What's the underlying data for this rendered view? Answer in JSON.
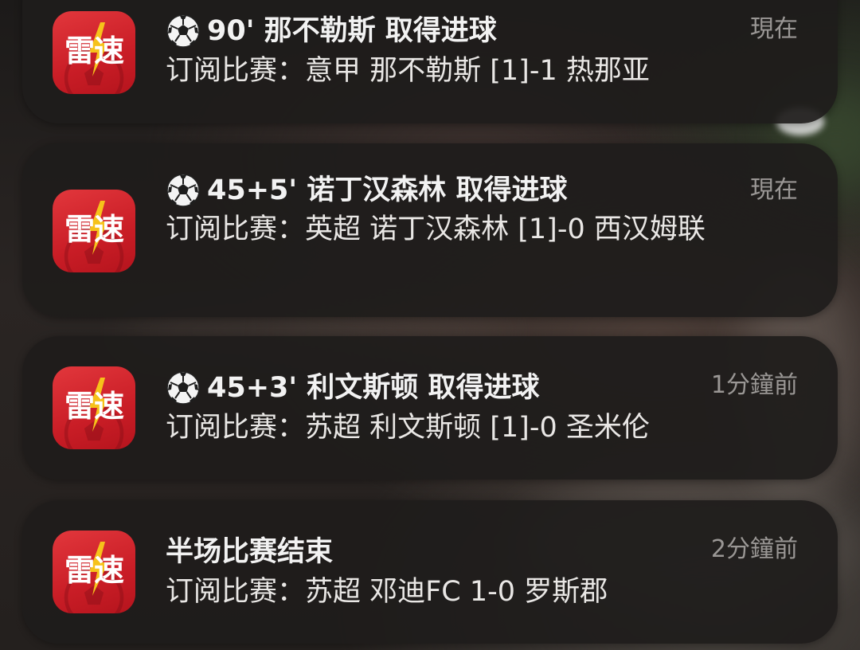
{
  "app": {
    "logo_text": "雷速",
    "icon": "leisu-app-icon",
    "brand_color": "#d62a30"
  },
  "notifications": [
    {
      "has_ball_icon": true,
      "title": "90' 那不勒斯 取得进球",
      "time": "現在",
      "body": "订阅比赛：意甲 那不勒斯 [1]-1 热那亚"
    },
    {
      "has_ball_icon": true,
      "title": "45+5' 诺丁汉森林 取得进球",
      "time": "現在",
      "body": "订阅比赛：英超 诺丁汉森林 [1]-0 西汉姆联"
    },
    {
      "has_ball_icon": true,
      "title": "45+3' 利文斯顿 取得进球",
      "time": "1分鐘前",
      "body": "订阅比赛：苏超 利文斯顿 [1]-0 圣米伦"
    },
    {
      "has_ball_icon": false,
      "title": "半场比赛结束",
      "time": "2分鐘前",
      "body": "订阅比赛：苏超 邓迪FC 1-0 罗斯郡"
    }
  ]
}
